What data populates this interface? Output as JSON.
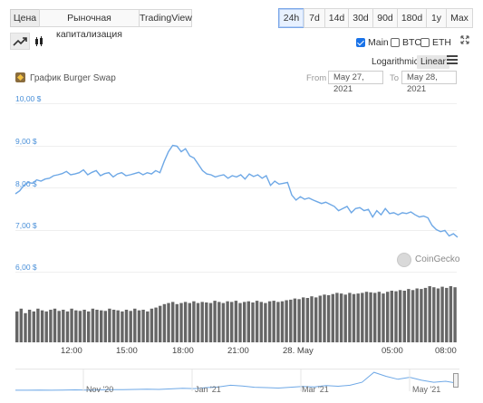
{
  "tabs": [
    "Цена",
    "Рыночная капитализация",
    "TradingView"
  ],
  "ranges": [
    "24h",
    "7d",
    "14d",
    "30d",
    "90d",
    "180d",
    "1y",
    "Max"
  ],
  "active_range": "24h",
  "series_toggles": [
    {
      "label": "Main",
      "checked": true
    },
    {
      "label": "BTC",
      "checked": false
    },
    {
      "label": "ETH",
      "checked": false
    }
  ],
  "scale": {
    "logarithmic": "Logarithmic",
    "linear": "Linear"
  },
  "chart_title": "График Burger Swap",
  "date_range": {
    "from_label": "From",
    "from": "May 27, 2021",
    "to_label": "To",
    "to": "May 28, 2021"
  },
  "watermark": "CoinGecko",
  "colors": {
    "line": "#6ea8e6",
    "volume": "#666666",
    "accent": "#1a73e8",
    "logo": "#8a6c3d"
  },
  "navigator_labels": [
    "Nov '20",
    "Jan '21",
    "Mar '21",
    "May '21"
  ],
  "chart_data": {
    "type": "line",
    "yticks": [
      "10,00 $",
      "9,00 $",
      "8,00 $",
      "7,00 $",
      "6,00 $"
    ],
    "ylim": [
      6,
      10
    ],
    "xticks": [
      "12:00",
      "15:00",
      "18:00",
      "21:00",
      "28. May",
      "05:00",
      "08:00"
    ],
    "price": [
      7.85,
      7.92,
      8.05,
      8.12,
      8.1,
      8.18,
      8.15,
      8.2,
      8.22,
      8.28,
      8.3,
      8.33,
      8.38,
      8.3,
      8.32,
      8.35,
      8.42,
      8.3,
      8.36,
      8.4,
      8.28,
      8.33,
      8.35,
      8.25,
      8.32,
      8.35,
      8.28,
      8.3,
      8.33,
      8.36,
      8.3,
      8.35,
      8.32,
      8.4,
      8.35,
      8.62,
      8.85,
      9.0,
      8.98,
      8.85,
      8.92,
      8.75,
      8.7,
      8.55,
      8.4,
      8.32,
      8.3,
      8.25,
      8.28,
      8.3,
      8.22,
      8.28,
      8.25,
      8.3,
      8.2,
      8.32,
      8.26,
      8.3,
      8.22,
      8.28,
      8.05,
      8.15,
      8.08,
      8.1,
      8.12,
      7.82,
      7.7,
      7.78,
      7.72,
      7.75,
      7.7,
      7.66,
      7.62,
      7.65,
      7.6,
      7.55,
      7.45,
      7.5,
      7.55,
      7.4,
      7.5,
      7.52,
      7.45,
      7.48,
      7.3,
      7.45,
      7.35,
      7.5,
      7.38,
      7.4,
      7.35,
      7.4,
      7.38,
      7.42,
      7.35,
      7.3,
      7.32,
      7.28,
      7.1,
      7.0,
      6.95,
      6.98,
      6.85,
      6.9,
      6.82
    ],
    "volume": [
      0.55,
      0.6,
      0.52,
      0.58,
      0.55,
      0.6,
      0.57,
      0.55,
      0.58,
      0.6,
      0.56,
      0.58,
      0.55,
      0.6,
      0.57,
      0.56,
      0.58,
      0.55,
      0.6,
      0.58,
      0.57,
      0.56,
      0.6,
      0.58,
      0.57,
      0.55,
      0.58,
      0.56,
      0.6,
      0.57,
      0.58,
      0.55,
      0.6,
      0.62,
      0.65,
      0.68,
      0.7,
      0.72,
      0.68,
      0.7,
      0.72,
      0.7,
      0.73,
      0.7,
      0.72,
      0.71,
      0.7,
      0.74,
      0.72,
      0.7,
      0.73,
      0.72,
      0.74,
      0.7,
      0.72,
      0.73,
      0.71,
      0.74,
      0.72,
      0.7,
      0.73,
      0.74,
      0.72,
      0.73,
      0.75,
      0.76,
      0.78,
      0.77,
      0.8,
      0.79,
      0.82,
      0.8,
      0.83,
      0.85,
      0.84,
      0.86,
      0.88,
      0.87,
      0.85,
      0.88,
      0.86,
      0.87,
      0.88,
      0.9,
      0.89,
      0.88,
      0.9,
      0.87,
      0.9,
      0.92,
      0.91,
      0.93,
      0.92,
      0.95,
      0.93,
      0.96,
      0.95,
      0.97,
      1.0,
      0.98,
      0.96,
      0.99,
      0.97,
      1.0,
      0.98
    ],
    "navigator": [
      0.05,
      0.05,
      0.06,
      0.05,
      0.06,
      0.07,
      0.06,
      0.07,
      0.08,
      0.08,
      0.09,
      0.1,
      0.09,
      0.12,
      0.15,
      0.13,
      0.18,
      0.22,
      0.3,
      0.26,
      0.2,
      0.18,
      0.16,
      0.2,
      0.24,
      0.22,
      0.28,
      0.25,
      0.3,
      0.45,
      0.95,
      0.75,
      0.6,
      0.7,
      0.55,
      0.45,
      0.5,
      0.4
    ]
  }
}
